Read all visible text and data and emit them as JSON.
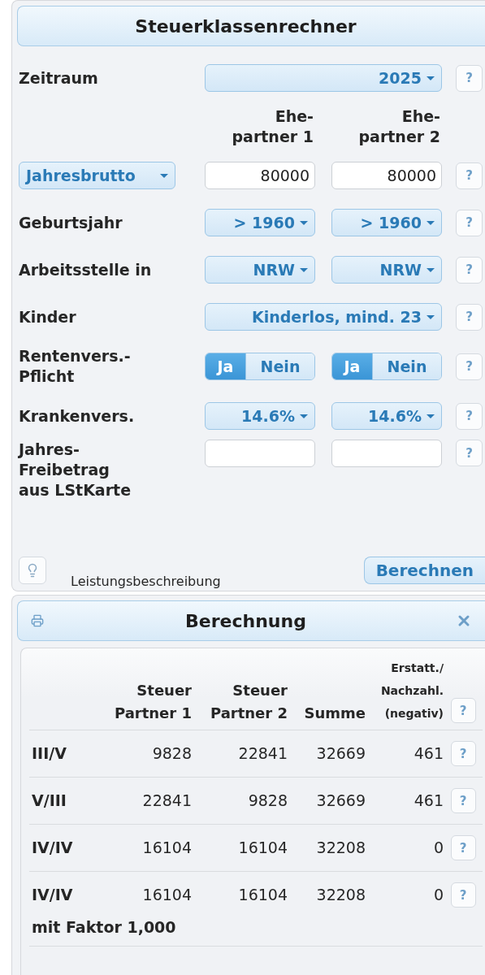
{
  "form": {
    "title": "Steuerklassenrechner",
    "rows": [
      {
        "kind": "select-wide",
        "label": "Zeitraum",
        "value": "2025"
      },
      {
        "kind": "header",
        "columns": [
          "Ehe-\npartner 1",
          "Ehe-\npartner 2"
        ]
      },
      {
        "kind": "amount",
        "label": "Jahresbrutto",
        "values": [
          "80000",
          "80000"
        ]
      },
      {
        "kind": "select",
        "label": "Geburtsjahr",
        "values": [
          "> 1960",
          "> 1960"
        ]
      },
      {
        "kind": "select",
        "label": "Arbeitsstelle in",
        "values": [
          "NRW",
          "NRW"
        ]
      },
      {
        "kind": "select-wide",
        "label": "Kinder",
        "value": "Kinderlos, mind. 23"
      },
      {
        "kind": "toggle",
        "label": "Rentenvers.-\nPflicht",
        "partners": [
          [
            {
              "label": "Ja",
              "selected": true
            },
            {
              "label": "Nein",
              "selected": false
            }
          ],
          [
            {
              "label": "Ja",
              "selected": true
            },
            {
              "label": "Nein",
              "selected": false
            }
          ]
        ]
      },
      {
        "kind": "select",
        "label": "Krankenvers.",
        "values": [
          "14.6%",
          "14.6%"
        ]
      },
      {
        "kind": "amount-empty",
        "label": "Jahres-\nFreibetrag\naus LStKarte"
      }
    ],
    "help_label": "?",
    "description_link": "Leistungsbeschreibung",
    "submit": "Berechnen"
  },
  "results": {
    "title": "Berechnung",
    "columns": [
      "",
      "Steuer\nPartner 1",
      "Steuer\nPartner 2",
      "Summe",
      "Erstatt./\nNachzahl.\n(negativ)"
    ],
    "rows": [
      {
        "cells": [
          "III/V",
          "9828",
          "22841",
          "32669",
          "461"
        ]
      },
      {
        "cells": [
          "V/III",
          "22841",
          "9828",
          "32669",
          "461"
        ]
      },
      {
        "cells": [
          "IV/IV",
          "16104",
          "16104",
          "32208",
          "0"
        ]
      },
      {
        "cells": [
          "IV/IV",
          "16104",
          "16104",
          "32208",
          "0"
        ],
        "note": "mit Faktor 1,000"
      }
    ]
  }
}
